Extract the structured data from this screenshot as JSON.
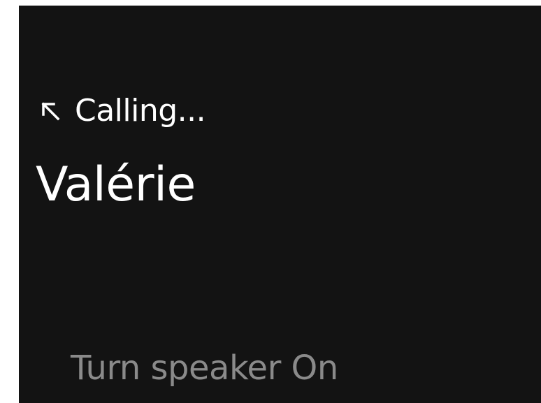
{
  "call": {
    "direction_icon": "outgoing-call-arrow-icon",
    "status": "Calling...",
    "contact_name": "Valérie"
  },
  "actions": {
    "speaker_label": "Turn speaker On"
  },
  "colors": {
    "background": "#131313",
    "primary_text": "#ffffff",
    "secondary_text": "#8a8a8a"
  }
}
